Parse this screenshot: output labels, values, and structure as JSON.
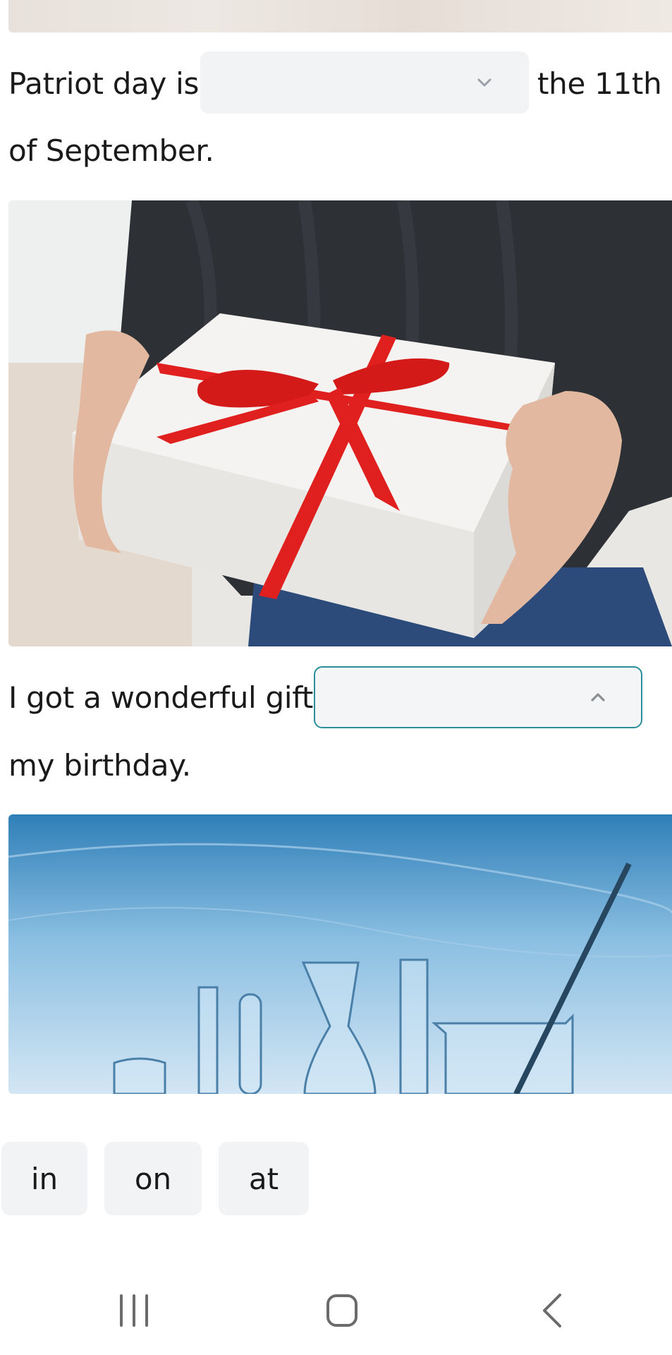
{
  "exercise": {
    "sentence1": {
      "part1": "Patriot day is",
      "part2": "the 11th",
      "part3": "of September.",
      "dropdown_value": "",
      "dropdown_state": "collapsed"
    },
    "image1": {
      "icon": "gift-box-photo"
    },
    "sentence2": {
      "part1": "I got a wonderful gift",
      "part2": "my birthday.",
      "dropdown_value": "",
      "dropdown_state": "expanded"
    },
    "image2": {
      "icon": "laboratory-glassware-photo"
    }
  },
  "answer_options": [
    {
      "label": "in"
    },
    {
      "label": "on"
    },
    {
      "label": "at"
    }
  ],
  "colors": {
    "dropdown_bg": "#f2f3f5",
    "dropdown_active_border": "#2a8f9a",
    "text": "#1a1a1a",
    "chevron": "#9aa0a6"
  },
  "navigation": {
    "recent_apps_icon": "recent-apps-icon",
    "home_icon": "home-icon",
    "back_icon": "back-icon"
  }
}
